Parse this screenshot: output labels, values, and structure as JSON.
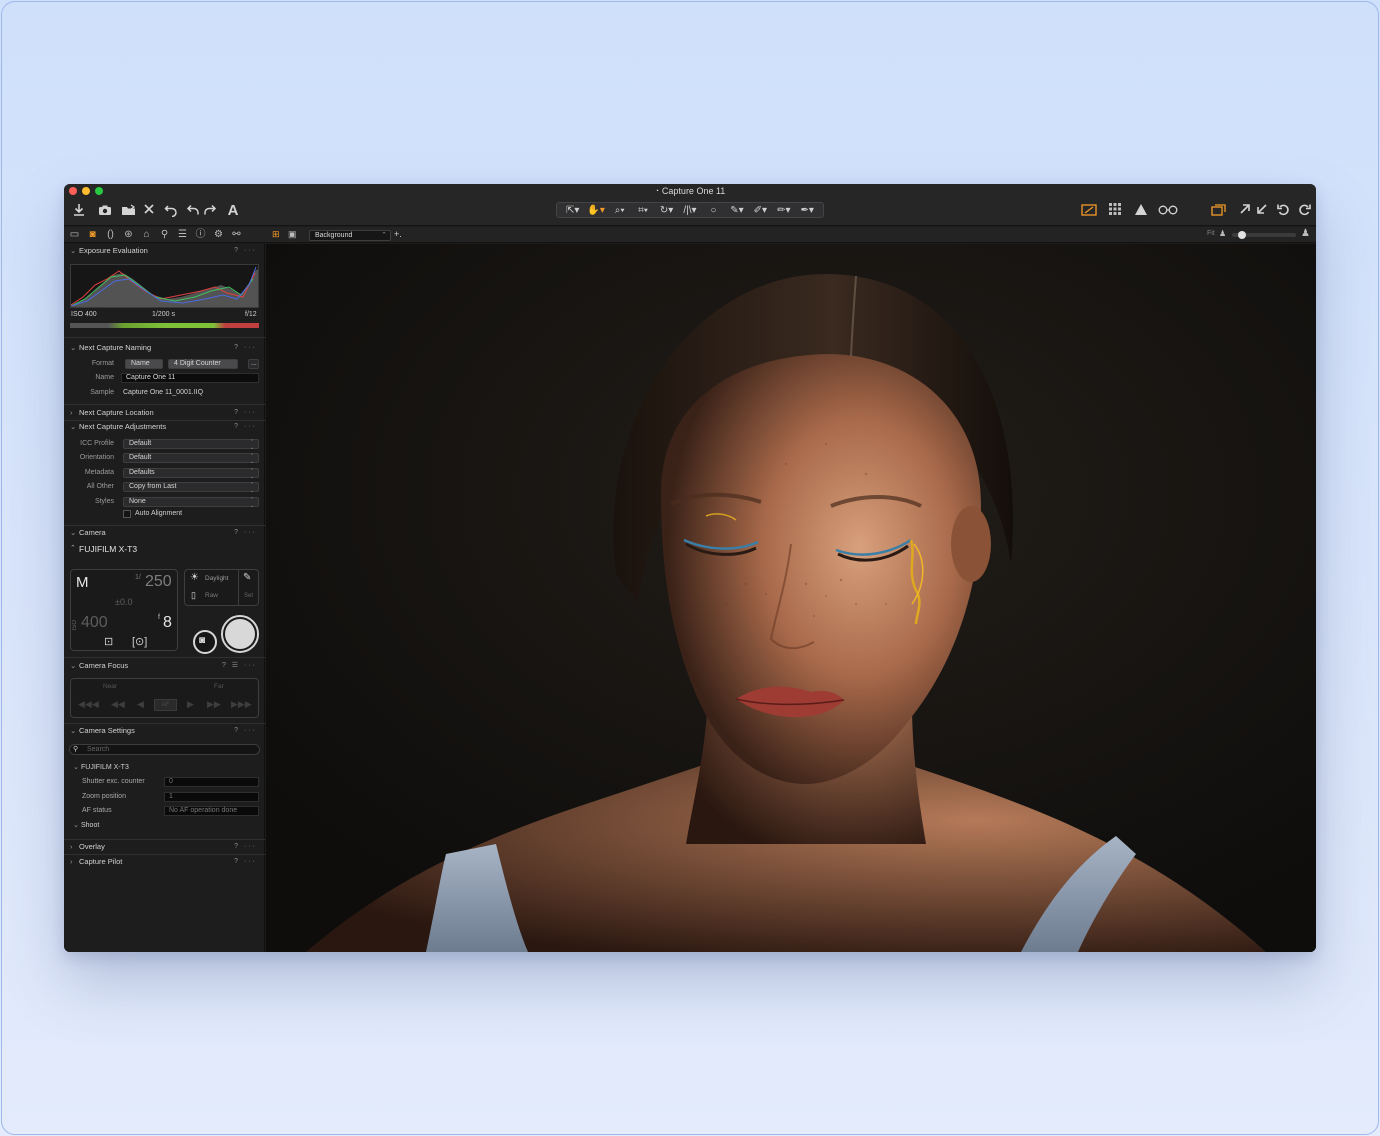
{
  "window": {
    "title": "Capture One 11",
    "traffic_colors": [
      "#fe5f57",
      "#febc2e",
      "#28c840"
    ]
  },
  "toolbar": {
    "left_icons": [
      "import-icon",
      "camera-icon",
      "move-to-folder-icon",
      "delete-icon",
      "undo-icon",
      "undo-icon",
      "redo-icon",
      "text-icon"
    ],
    "cursor_tools": [
      "select-cursor-icon",
      "pan-cursor-icon",
      "zoom-cursor-icon",
      "crop-cursor-icon",
      "rotate-cursor-icon",
      "keystone-cursor-icon",
      "circle-cursor-icon",
      "brush-cursor-icon",
      "eraser-cursor-icon",
      "gradient-cursor-icon",
      "picker-cursor-icon"
    ],
    "right_icons": [
      "exposure-warning-icon",
      "grid-icon",
      "warning-icon",
      "proof-glasses-icon",
      "copy-adjustments-icon",
      "apply-icon",
      "rotate-left-icon",
      "rotate-right-icon"
    ],
    "accent": "#f39b28"
  },
  "subbar": {
    "background_layer": "Background",
    "add_layer": "+.",
    "fit_label": "Fit"
  },
  "exposure": {
    "title": "Exposure Evaluation",
    "iso": "ISO 400",
    "shutter": "1/200 s",
    "aperture": "f/12"
  },
  "naming": {
    "title": "Next Capture Naming",
    "format_label": "Format",
    "format_token1": "Name",
    "format_token2": "4 Digit Counter",
    "name_label": "Name",
    "name_value": "Capture One 11",
    "sample_label": "Sample",
    "sample_value": "Capture One 11_0001.IIQ",
    "more_button": "..."
  },
  "location": {
    "title": "Next Capture Location"
  },
  "adjustments": {
    "title": "Next Capture Adjustments",
    "rows": [
      {
        "label": "ICC Profile",
        "value": "Default"
      },
      {
        "label": "Orientation",
        "value": "Default"
      },
      {
        "label": "Metadata",
        "value": "Defaults"
      },
      {
        "label": "All Other",
        "value": "Copy from Last"
      },
      {
        "label": "Styles",
        "value": "None"
      }
    ],
    "auto_alignment": "Auto Alignment"
  },
  "camera": {
    "title": "Camera",
    "model": "FUJIFILM X-T3",
    "mode": "M",
    "shutter_prefix": "1/",
    "shutter": "250",
    "ev": "±0.0",
    "iso_label": "ISO",
    "iso": "400",
    "f_prefix": "f",
    "aperture": "8",
    "wb_label": "Daylight",
    "format_label": "Raw",
    "set_label": "Set"
  },
  "focus": {
    "title": "Camera Focus",
    "near": "Near",
    "far": "Far",
    "af": "AF"
  },
  "settings": {
    "title": "Camera Settings",
    "search_placeholder": "Search",
    "group": "FUJIFILM X-T3",
    "rows": [
      {
        "label": "Shutter exc. counter",
        "value": "0"
      },
      {
        "label": "Zoom position",
        "value": "1"
      },
      {
        "label": "AF status",
        "value": "No AF operation done"
      }
    ],
    "shoot_group": "Shoot"
  },
  "overlay": {
    "title": "Overlay"
  },
  "pilot": {
    "title": "Capture Pilot"
  }
}
